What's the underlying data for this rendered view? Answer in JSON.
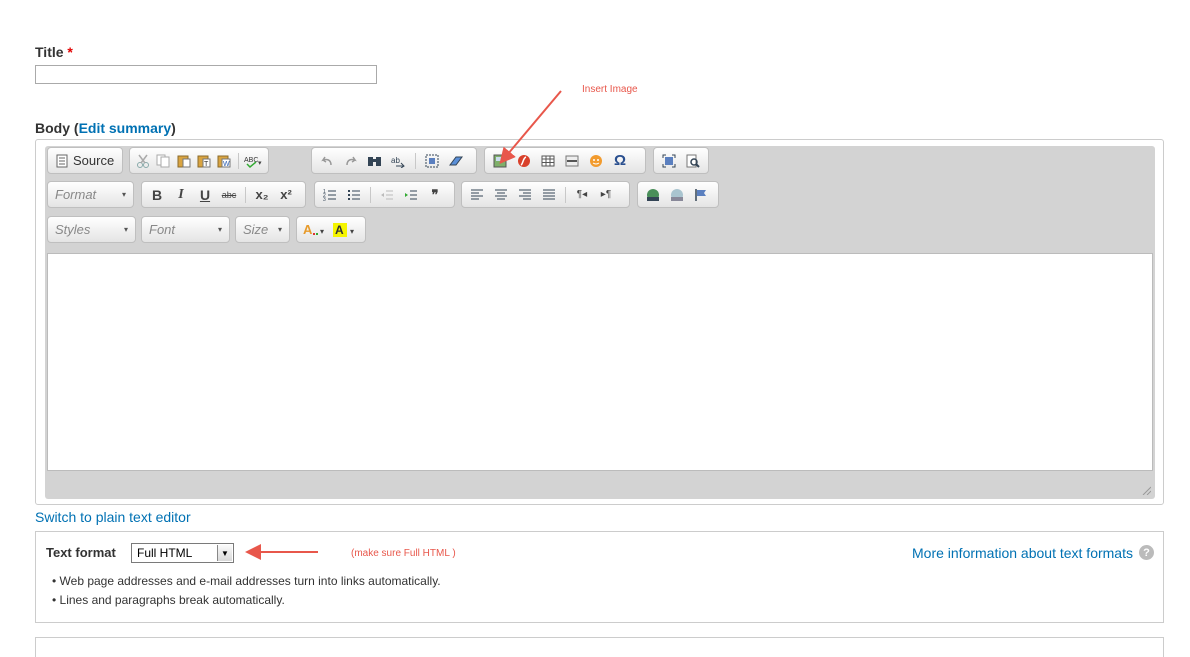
{
  "title_field": {
    "label": "Title",
    "required_marker": "*",
    "value": ""
  },
  "body_field": {
    "label": "Body",
    "open_paren": " (",
    "edit_summary_link": "Edit summary",
    "close_paren": ")"
  },
  "annotations": {
    "insert_image": "Insert Image",
    "make_sure": "(make sure Full HTML )"
  },
  "toolbar": {
    "source_label": "Source",
    "format_placeholder": "Format",
    "styles_placeholder": "Styles",
    "font_placeholder": "Font",
    "size_placeholder": "Size",
    "buttons": {
      "bold": "B",
      "italic": "I",
      "underline": "U",
      "strike": "abc",
      "subscript": "x₂",
      "superscript": "x²",
      "blockquote": "❞",
      "omega": "Ω",
      "paragraph_ltr": "¶◂",
      "paragraph_rtl": "▸¶"
    }
  },
  "switch_link": "Switch to plain text editor",
  "text_format": {
    "label": "Text format",
    "selected": "Full HTML",
    "more_info_link": "More information about text formats",
    "help_icon": "?",
    "tips": [
      "Web page addresses and e-mail addresses turn into links automatically.",
      "Lines and paragraphs break automatically."
    ]
  },
  "colors": {
    "link": "#0071b3",
    "annotation": "#e8574b",
    "required": "#e10000"
  }
}
